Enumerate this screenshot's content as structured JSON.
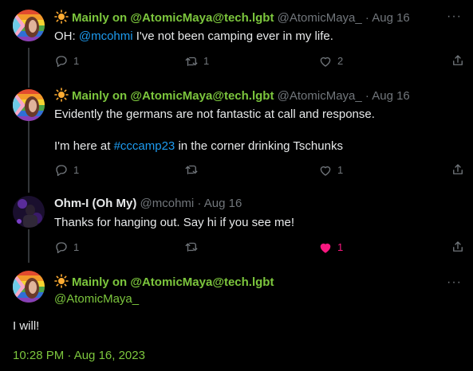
{
  "tweets": [
    {
      "display_name": "Mainly on @AtomicMaya@tech.lgbt",
      "handle": "@AtomicMaya_",
      "sep": "·",
      "date": "Aug 16",
      "text_prefix": "OH: ",
      "mention": "@mcohmi",
      "text_suffix": " I've not been camping ever in my life.",
      "replies": "1",
      "retweets": "1",
      "likes": "2"
    },
    {
      "display_name": "Mainly on @AtomicMaya@tech.lgbt",
      "handle": "@AtomicMaya_",
      "sep": "·",
      "date": "Aug 16",
      "line1": "Evidently the germans are not fantastic at call and response.",
      "line2_prefix": "I'm here at ",
      "hashtag": "#cccamp23",
      "line2_suffix": " in the corner drinking Tschunks",
      "replies": "1",
      "retweets": "",
      "likes": "1"
    },
    {
      "display_name": "Ohm-I (Oh My)",
      "handle": "@mcohmi",
      "sep": "·",
      "date": "Aug 16",
      "text": "Thanks for hanging out.  Say hi if you see me!",
      "replies": "1",
      "retweets": "",
      "likes": "1"
    }
  ],
  "focus": {
    "display_name": "Mainly on @AtomicMaya@tech.lgbt",
    "handle": "@AtomicMaya_",
    "text": "I will!",
    "timestamp": "10:28 PM · Aug 16, 2023"
  },
  "more_label": "···",
  "colors": {
    "background": "#000000",
    "text": "#e7e9ea",
    "muted": "#71767b",
    "accent_green": "#7cc63d",
    "link_blue": "#1d9bf0",
    "like_pink": "#f91880"
  },
  "icons": [
    "sun-emoji-icon",
    "reply-icon",
    "retweet-icon",
    "like-icon",
    "share-icon",
    "more-icon"
  ]
}
